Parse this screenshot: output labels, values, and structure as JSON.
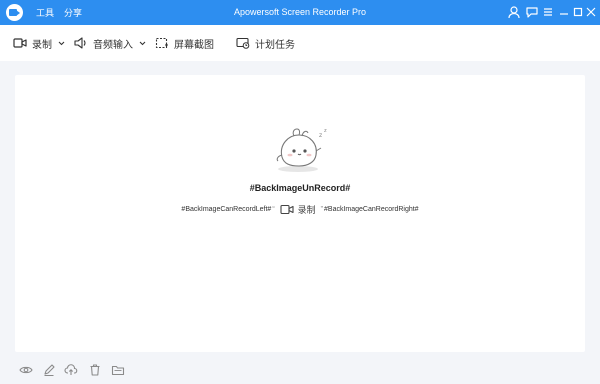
{
  "titlebar": {
    "app_title": "Apowersoft Screen Recorder Pro",
    "menu": [
      "工具",
      "分享"
    ],
    "color": "#2d8ef0"
  },
  "toolbar": {
    "record_label": "录制",
    "audio_label": "音频输入",
    "screenshot_label": "屏幕截图",
    "schedule_label": "计划任务"
  },
  "empty_state": {
    "title": "#BackImageUnRecord#",
    "hint_left": "#BackImageCanRecordLeft#",
    "record_link": "录制",
    "hint_right": "#BackImageCanRecordRight#",
    "quote_open": "“",
    "quote_close": "”"
  },
  "bottom_icons": [
    "eye-icon",
    "pencil-icon",
    "cloud-upload-icon",
    "trash-icon",
    "folder-icon"
  ]
}
